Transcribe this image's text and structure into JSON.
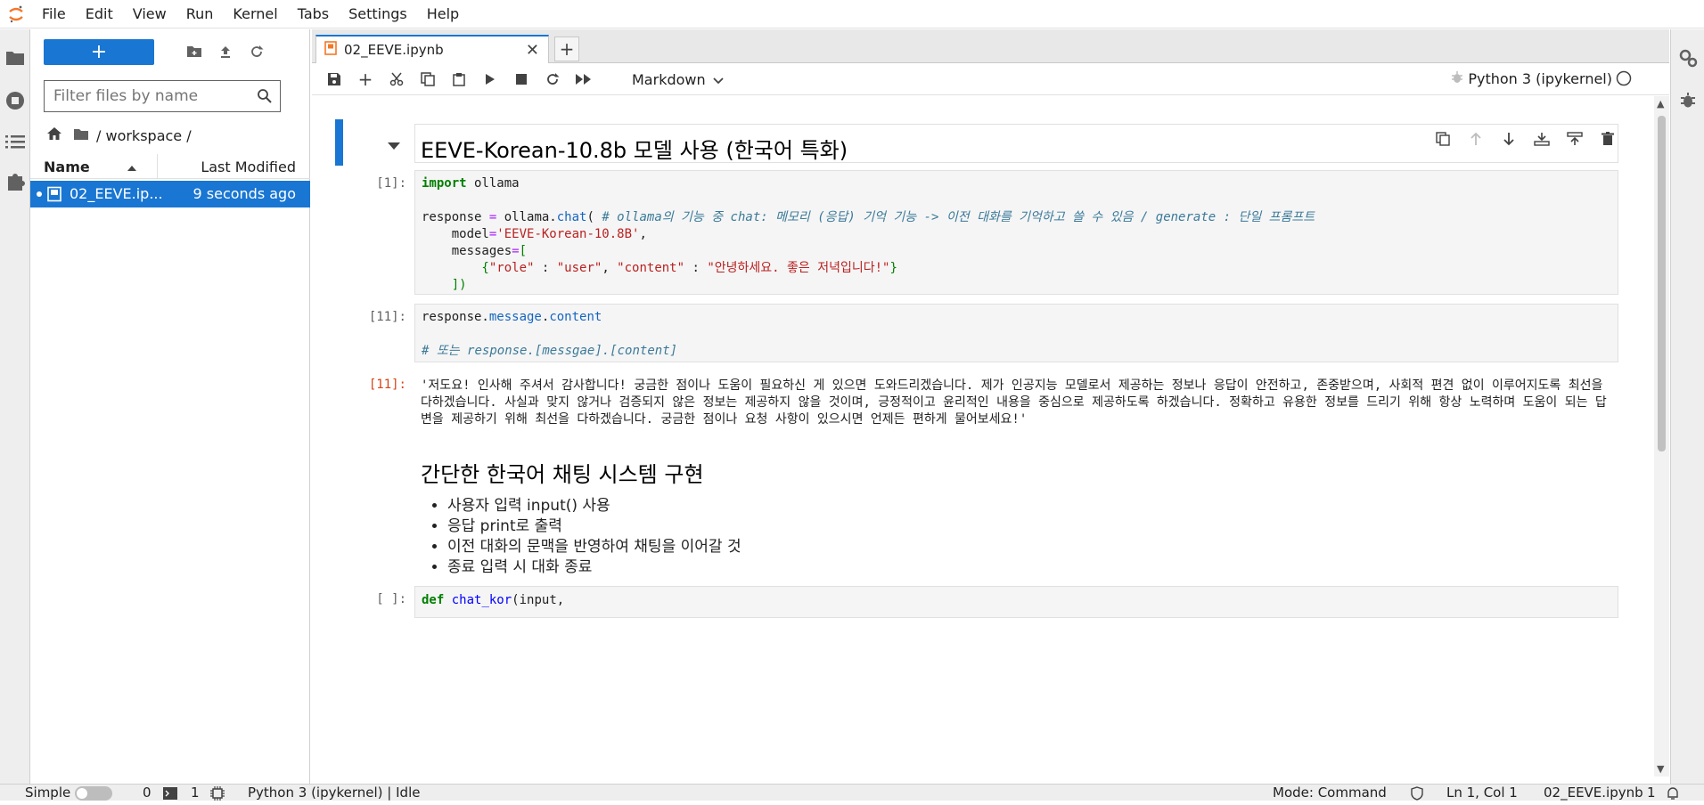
{
  "menubar": {
    "items": [
      "File",
      "Edit",
      "View",
      "Run",
      "Kernel",
      "Tabs",
      "Settings",
      "Help"
    ]
  },
  "left_rail": {
    "icons": [
      "folder-icon",
      "running-icon",
      "toc-icon",
      "extension-icon"
    ]
  },
  "right_rail": {
    "icons": [
      "property-inspector-icon",
      "debugger-icon"
    ]
  },
  "file_browser": {
    "new_label": "+",
    "filter_placeholder": "Filter files by name",
    "breadcrumb_path": "/ workspace /",
    "columns": {
      "name": "Name",
      "modified": "Last Modified"
    },
    "files": [
      {
        "name": "02_EEVE.ip...",
        "modified": "9 seconds ago"
      }
    ]
  },
  "tabs": [
    {
      "label": "02_EEVE.ipynb"
    }
  ],
  "toolbar": {
    "cell_type": "Markdown",
    "kernel_name": "Python 3 (ipykernel)"
  },
  "cells": {
    "heading1": "EEVE-Korean-10.8b 모델 사용 (한국어 특화)",
    "prompt1": "[1]:",
    "prompt2": "[11]:",
    "prompt_out": "[11]:",
    "prompt_empty": "[ ]:",
    "code1": {
      "l1_kw": "import",
      "l1_rest": " ollama",
      "l3_a": "response ",
      "l3_eq": "=",
      "l3_b": " ollama.",
      "l3_fn": "chat",
      "l3_paren": "( ",
      "l3_comment": "# ollama의 기능 중 chat: 메모리 (응답) 기억 기능 -> 이전 대화를 기억하고 쓸 수 있음 / generate : 단일 프롬프트",
      "l4_a": "    model",
      "l4_eq": "=",
      "l4_str": "'EEVE-Korean-10.8B'",
      "l4_c": ",",
      "l5_a": "    messages",
      "l5_eq": "=",
      "l5_br": "[",
      "l6_open": "        {",
      "l6_s1": "\"role\"",
      "l6_c1": " : ",
      "l6_s2": "\"user\"",
      "l6_c2": ", ",
      "l6_s3": "\"content\"",
      "l6_c3": " : ",
      "l6_s4": "\"안녕하세요. 좋은 저녁입니다!\"",
      "l6_close": "}",
      "l7_br": "    ])",
      "l7_end": ""
    },
    "code2": {
      "l1_a": "response.",
      "l1_attr1": "message",
      "l1_dot": ".",
      "l1_attr2": "content",
      "l3_comment": "# 또는 response.[messgae].[content]"
    },
    "output": "'저도요! 인사해 주셔서 감사합니다! 궁금한 점이나 도움이 필요하신 게 있으면 도와드리겠습니다. 제가 인공지능 모델로서 제공하는 정보나 응답이 안전하고, 존중받으며, 사회적 편견 없이 이루어지도록 최선을 다하겠습니다. 사실과 맞지 않거나 검증되지 않은 정보는 제공하지 않을 것이며, 긍정적이고 윤리적인 내용을 중심으로 제공하도록 하겠습니다. 정확하고 유용한 정보를 드리기 위해 항상 노력하며 도움이 되는 답변을 제공하기 위해 최선을 다하겠습니다. 궁금한 점이나 요청 사항이 있으시면 언제든 편하게 물어보세요!'",
    "heading2": "간단한 한국어 채팅 시스템 구현",
    "bullets": [
      "사용자 입력 input() 사용",
      "응답 print로 출력",
      "이전 대화의 문맥을 반영하여 채팅을 이어갈 것",
      "종료 입력 시 대화 종료"
    ],
    "code3": {
      "kw": "def",
      "fn": "chat_kor",
      "rest": "(input,"
    }
  },
  "statusbar": {
    "simple_label": "Simple",
    "terminals": "0",
    "kernels": "1",
    "kernel_status": "Python 3 (ipykernel) | Idle",
    "mode": "Mode: Command",
    "cursor": "Ln 1, Col 1",
    "file": "02_EEVE.ipynb",
    "notifications": "1"
  },
  "colors": {
    "accent": "#1976d2",
    "keyword": "#008000",
    "string": "#ba2121",
    "comment": "#3b7a99"
  }
}
